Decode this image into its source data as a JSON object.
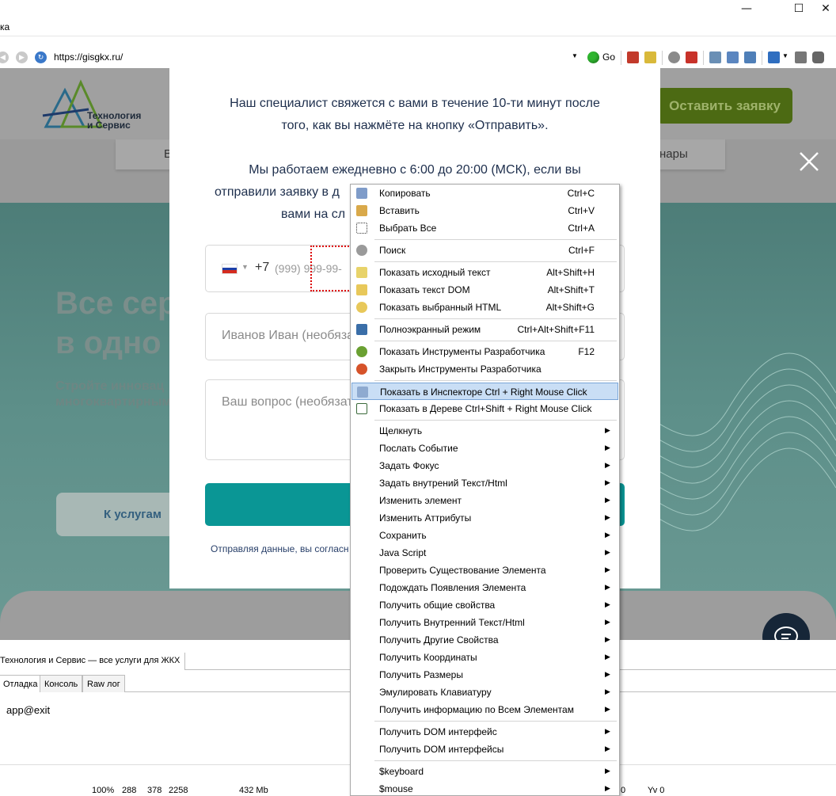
{
  "window": {
    "menu_fragment": "ка",
    "minimize_glyph": "—",
    "maximize_glyph": "☐",
    "close_glyph": "✕"
  },
  "toolbar": {
    "url": "https://gisgkx.ru/",
    "go_label": "Go"
  },
  "site": {
    "logo_line1": "Технология",
    "logo_line2": "и Сервис",
    "header_cta": "Оставить заявку",
    "nav_left_fragment": "В",
    "nav_right_fragment": "нары",
    "hero_title_line1": "Все сер",
    "hero_title_line2": "в одно",
    "hero_sub_line1": "Стройте инновац",
    "hero_sub_line2": "многоквартирным",
    "hero_button": "К услугам"
  },
  "modal": {
    "text_line1": "Наш специалист свяжется с вами в течение 10-ти минут после",
    "text_line2": "того, как вы нажмёте на кнопку «Отправить».",
    "text_line3": "Мы работаем ежедневно с 6:00 до 20:00 (МСК), если вы",
    "text_line4": "отправили заявку в д",
    "text_line5": "вами на сл",
    "phone_prefix": "+7",
    "phone_placeholder": "(999) 999-99-",
    "name_placeholder": "Иванов Иван (необяза",
    "question_placeholder": "Ваш вопрос (необязат",
    "consent_fragment": "Отправляя данные, вы согласн"
  },
  "context_menu": {
    "items": [
      {
        "label": "Копировать",
        "shortcut": "Ctrl+C",
        "icon": "copy-icon"
      },
      {
        "label": "Вставить",
        "shortcut": "Ctrl+V",
        "icon": "paste-icon"
      },
      {
        "label": "Выбрать Все",
        "shortcut": "Ctrl+A",
        "icon": "select-all-icon"
      },
      {
        "label": "Поиск",
        "shortcut": "Ctrl+F",
        "icon": "search-icon"
      },
      {
        "label": "Показать исходный текст",
        "shortcut": "Alt+Shift+H",
        "icon": "source-icon"
      },
      {
        "label": "Показать текст DOM",
        "shortcut": "Alt+Shift+T",
        "icon": "dom-text-icon"
      },
      {
        "label": "Показать выбранный HTML",
        "shortcut": "Alt+Shift+G",
        "icon": "html-icon"
      },
      {
        "label": "Полноэкранный режим",
        "shortcut": "Ctrl+Alt+Shift+F11",
        "icon": "fullscreen-icon"
      },
      {
        "label": "Показать Инструменты Разработчика",
        "shortcut": "F12",
        "icon": "bug-icon"
      },
      {
        "label": "Закрыть Инструменты Разработчика",
        "shortcut": "",
        "icon": "bug-close-icon"
      },
      {
        "label": "Показать в Инспекторе Ctrl + Right Mouse Click",
        "shortcut": "",
        "icon": "inspector-icon"
      },
      {
        "label": "Показать в Дереве Ctrl+Shift + Right Mouse Click",
        "shortcut": "",
        "icon": "tree-icon"
      },
      {
        "label": "Щелкнуть"
      },
      {
        "label": "Послать Событие"
      },
      {
        "label": "Задать Фокус"
      },
      {
        "label": "Задать внутрений Текст/Html"
      },
      {
        "label": "Изменить элемент"
      },
      {
        "label": "Изменить Аттрибуты"
      },
      {
        "label": "Сохранить"
      },
      {
        "label": "Java Script"
      },
      {
        "label": "Проверить Существование Элемента"
      },
      {
        "label": "Подождать Появления Элемента"
      },
      {
        "label": "Получить общие свойства"
      },
      {
        "label": "Получить Внутренний Текст/Html"
      },
      {
        "label": "Получить Другие Свойства"
      },
      {
        "label": "Получить Координаты"
      },
      {
        "label": "Получить Размеры"
      },
      {
        "label": "Эмулировать Клавиатуру"
      },
      {
        "label": "Получить информацию по Всем Элементам"
      },
      {
        "label": "Получить DOM интерфейс"
      },
      {
        "label": "Получить DOM интерфейсы"
      },
      {
        "label": "$keyboard"
      },
      {
        "label": "$mouse"
      }
    ]
  },
  "debug": {
    "page_tab": "Технология и Сервис — все услуги для ЖКХ",
    "tabs": [
      "Отладка",
      "Консоль",
      "Raw лог"
    ],
    "log_line": "app@exit",
    "status": {
      "zoom": "100%",
      "val1": "288",
      "val2": "378",
      "val3": "2258",
      "memory": "432 Mb",
      "right_fragment": "0",
      "yv": "Yv 0"
    }
  },
  "colors": {
    "submit_teal": "#0a9695",
    "cta_green": "#4c6a13",
    "menu_highlight": "#c9def5",
    "debug_selection": "#dd0000"
  }
}
